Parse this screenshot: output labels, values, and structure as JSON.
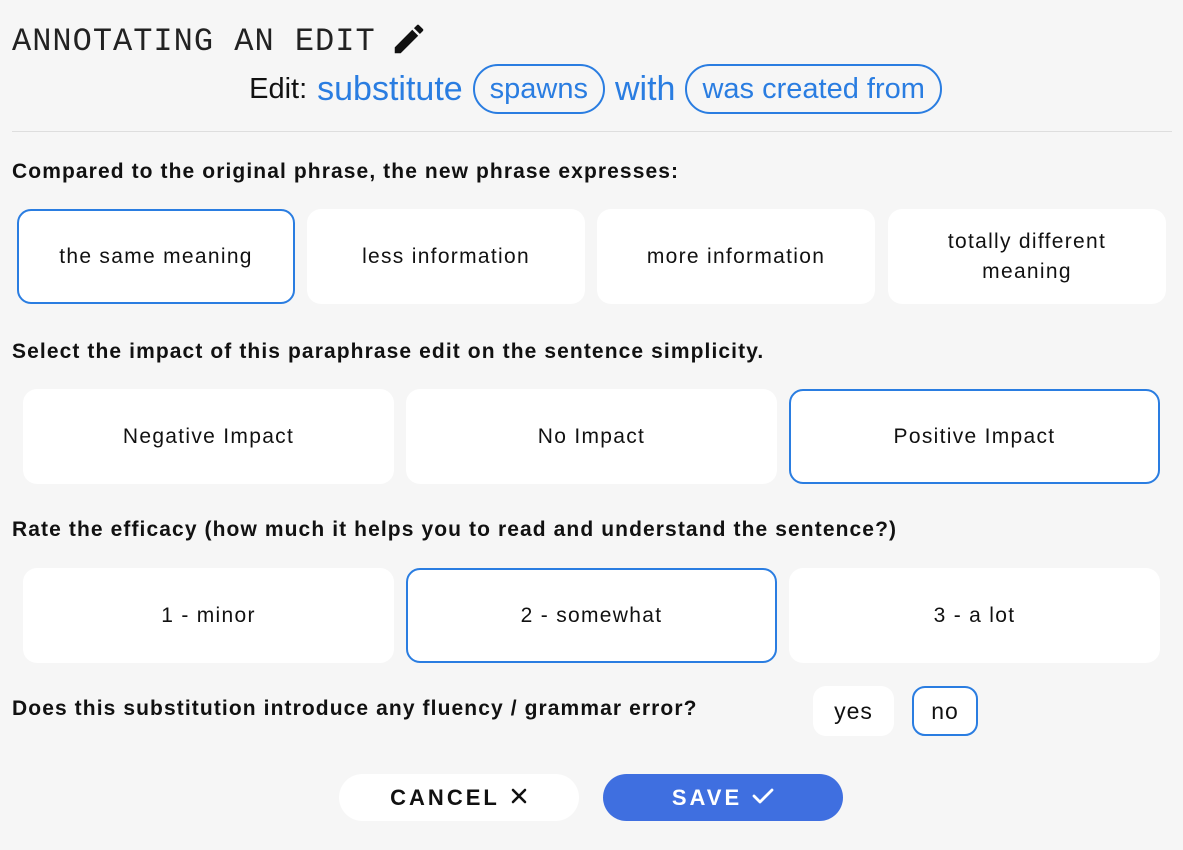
{
  "header": {
    "title": "ANNOTATING AN EDIT",
    "edit_label": "Edit:",
    "action": "substitute",
    "original": "spawns",
    "connector": "with",
    "replacement": "was created from"
  },
  "q1": {
    "text": "Compared to the original phrase, the new phrase expresses:",
    "options": [
      "the same meaning",
      "less information",
      "more information",
      "totally different meaning"
    ],
    "selected": "the same meaning"
  },
  "q2": {
    "text": "Select the impact of this paraphrase edit on the sentence simplicity.",
    "options": [
      "Negative Impact",
      "No Impact",
      "Positive Impact"
    ],
    "selected": "Positive Impact"
  },
  "q3": {
    "text": "Rate the efficacy (how much it helps you to read and understand the sentence?)",
    "options": [
      "1 - minor",
      "2 - somewhat",
      "3 - a lot"
    ],
    "selected": "2 - somewhat"
  },
  "q4": {
    "text": "Does this substitution introduce any fluency / grammar error?",
    "options": [
      "yes",
      "no"
    ],
    "selected": "no"
  },
  "buttons": {
    "cancel": "CANCEL",
    "save": "SAVE"
  },
  "icons": {
    "title": "pencil-icon",
    "cancel": "close-icon",
    "save": "checkmark-icon"
  },
  "colors": {
    "accent": "#2a7de1",
    "save_button": "#3f6fe0",
    "background": "#f6f6f6"
  }
}
